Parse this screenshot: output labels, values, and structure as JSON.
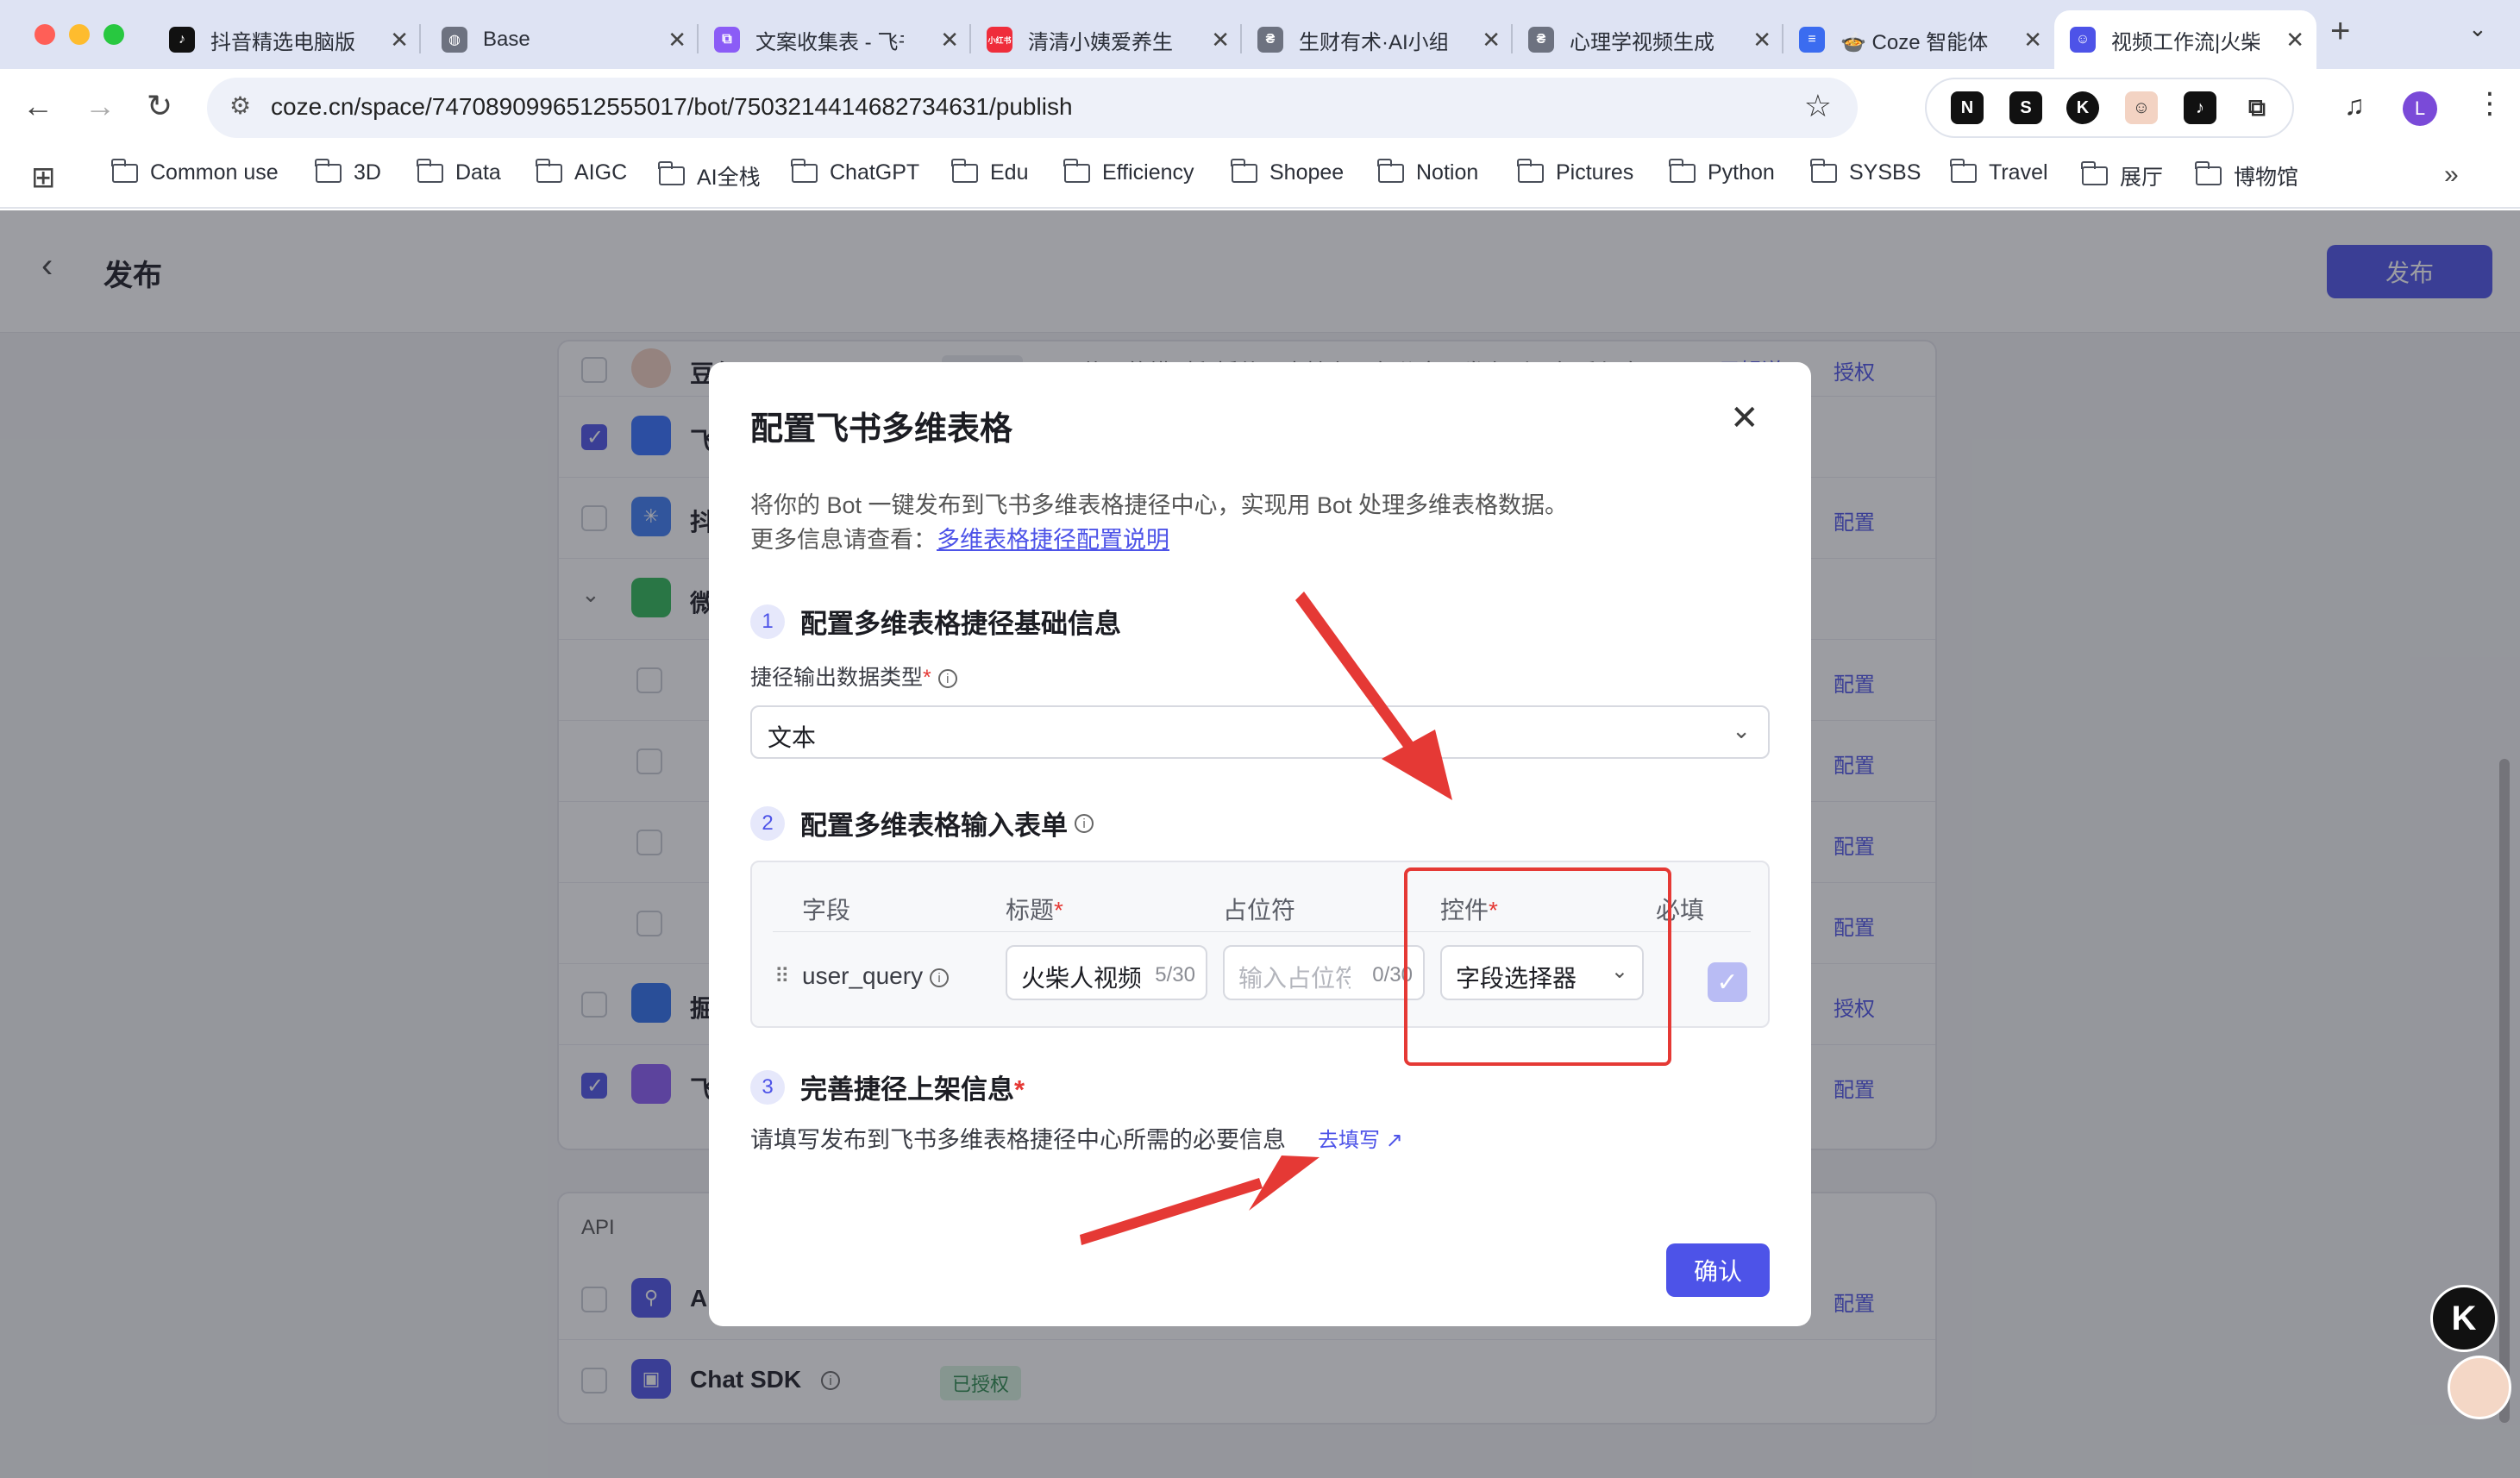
{
  "tabs": [
    {
      "title": "抖音精选电脑版",
      "fav": "♪",
      "color": "#111111"
    },
    {
      "title": "Base",
      "fav": "◍",
      "color": "#6d7280"
    },
    {
      "title": "文案收集表 - 飞书",
      "fav": "⧉",
      "color": "#8b5cf6"
    },
    {
      "title": "清清小姨爱养生",
      "fav": "小红书",
      "color": "#ef2d3b"
    },
    {
      "title": "生财有术·AI小组",
      "fav": "₴",
      "color": "#6d7280"
    },
    {
      "title": "心理学视频生成",
      "fav": "₴",
      "color": "#6d7280"
    },
    {
      "title": "🍲 Coze 智能体",
      "fav": "≡",
      "color": "#3b6cf0"
    },
    {
      "title": "视频工作流|火柴人",
      "fav": "☺",
      "color": "#4d53e8"
    }
  ],
  "toolbar": {
    "url": "coze.cn/space/7470890996512555017/bot/7503214414682734631/publish",
    "extensions": [
      "N",
      "S",
      "K",
      "☺",
      "♪",
      "⧉"
    ],
    "profile_initial": "L"
  },
  "bookmarks": [
    "Common use",
    "3D",
    "Data",
    "AIGC",
    "AI全栈",
    "ChatGPT",
    "Edu",
    "Efficiency",
    "Shopee",
    "Notion",
    "Pictures",
    "Python",
    "SYSBS",
    "Travel",
    "展厅",
    "博物馆"
  ],
  "page": {
    "title": "发布",
    "publish_label": "发布",
    "channels": [
      {
        "name": "豆包",
        "note": "使用的模型和插件不支持在豆包分享，发布到豆包后仅自己",
        "note_link": "了解详",
        "action": "授权",
        "tag": "未授权"
      },
      {
        "name": "飞",
        "action": ""
      },
      {
        "name": "抖",
        "action": "配置"
      },
      {
        "name": "微",
        "action": ""
      },
      {
        "name": "",
        "action": "配置"
      },
      {
        "name": "",
        "action": "配置"
      },
      {
        "name": "",
        "action": "配置"
      },
      {
        "name": "",
        "action": "配置"
      },
      {
        "name": "掘",
        "action": "授权"
      },
      {
        "name": "飞",
        "action": "配置"
      }
    ],
    "api_section": "API",
    "api_rows": [
      {
        "name": "AI",
        "action": "配置"
      },
      {
        "name": "Chat SDK",
        "tag": "已授权"
      }
    ]
  },
  "modal": {
    "title": "配置飞书多维表格",
    "desc1": "将你的 Bot 一键发布到飞书多维表格捷径中心，实现用 Bot 处理多维表格数据。",
    "desc2_prefix": "更多信息请查看：",
    "desc2_link": "多维表格捷径配置说明",
    "step1": {
      "num": "1",
      "title": "配置多维表格捷径基础信息",
      "label": "捷径输出数据类型",
      "select_value": "文本"
    },
    "step2": {
      "num": "2",
      "title": "配置多维表格输入表单",
      "headers": {
        "field": "字段",
        "title": "标题",
        "placeholder": "占位符",
        "control": "控件",
        "required": "必填"
      },
      "row": {
        "field": "user_query",
        "title_value": "火柴人视频",
        "title_count": "5/30",
        "placeholder_value": "输入占位符",
        "placeholder_count": "0/30",
        "control_value": "字段选择器",
        "required": true
      }
    },
    "step3": {
      "num": "3",
      "title": "完善捷径上架信息",
      "desc": "请填写发布到飞书多维表格捷径中心所需的必要信息",
      "link": "去填写 ↗"
    },
    "confirm_label": "确认"
  },
  "colors": {
    "accent": "#4d53e8",
    "annotation": "#e53935"
  }
}
